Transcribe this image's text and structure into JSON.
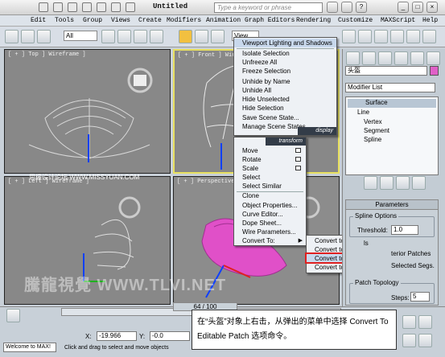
{
  "window": {
    "title": "Untitled",
    "search_placeholder": "Type a keyword or phrase"
  },
  "menubar": [
    "Edit",
    "Tools",
    "Group",
    "Views",
    "Create",
    "Modifiers",
    "Animation",
    "Graph Editors",
    "Rendering",
    "Customize",
    "MAXScript",
    "Help"
  ],
  "toolbar": {
    "selection_filter": "All",
    "view_dropdown": "View"
  },
  "viewports": {
    "top": "[ + ] Top ] Wireframe ]",
    "front": "[ + ] Front ] Wire",
    "left": "[ + ] Left ] Wireframe ]",
    "perspective": "[ + ] Perspective ]"
  },
  "quad_menu": {
    "upper": {
      "items": [
        "Viewport Lighting and Shadows",
        "Isolate Selection",
        "Unfreeze All",
        "Freeze Selection",
        "Unhide by Name",
        "Unhide All",
        "Hide Unselected",
        "Hide Selection",
        "Save Scene State...",
        "Manage Scene States..."
      ],
      "title": "display"
    },
    "lower": {
      "title": "transform",
      "items": [
        "Move",
        "Rotate",
        "Scale",
        "Select",
        "Select Similar",
        "Clone",
        "Object Properties...",
        "Curve Editor...",
        "Dope Sheet...",
        "Wire Parameters...",
        "Convert To:"
      ]
    },
    "submenu": [
      "Convert to Editable Mesh",
      "Convert to Editable Poly",
      "Convert to Editable Patch",
      "Convert to NURBS"
    ],
    "highlighted": "Convert to Editable Patch"
  },
  "command_panel": {
    "object_name": "头盔",
    "object_color": "#e060c8",
    "modifier_list": "Modifier List",
    "stack": [
      "Surface",
      "Line",
      "Vertex",
      "Segment",
      "Spline"
    ],
    "rollout": "Parameters",
    "spline_options": "Spline Options",
    "threshold_label": "Threshold:",
    "threshold_value": "1.0",
    "fragment_1": "ls",
    "fragment_2": "terior Patches",
    "fragment_3": "Selected Segs.",
    "patch_topology": "Patch Topology",
    "steps_label": "Steps:",
    "steps_value": "5"
  },
  "timeline": {
    "frame": "64 / 100"
  },
  "status": {
    "x_label": "X:",
    "x_value": "-19.966",
    "y_label": "Y:",
    "y_value": "-0.0",
    "welcome": "Welcome to MAX!",
    "prompt": "Click and drag to select and move objects"
  },
  "caption": "在“头盔”对象上右击，从弹出的菜单中选择 Convert To Editable Patch 选项命令。",
  "watermark": "騰龍視覺 WWW.TLVI.NET",
  "watermark_small": "思缘设计论坛 WWW.MISSYUAN.COM"
}
